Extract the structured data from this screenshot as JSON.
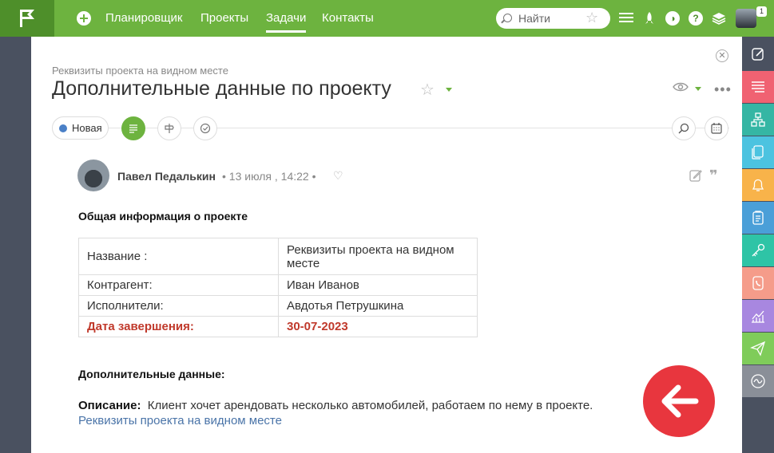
{
  "topbar": {
    "nav": [
      "Планировщик",
      "Проекты",
      "Задачи",
      "Контакты"
    ],
    "active_nav": "Задачи",
    "search_placeholder": "Найти",
    "user_badge": "1",
    "icons": [
      "plus-icon",
      "search-icon",
      "star-icon",
      "hamburger-icon",
      "rocket-icon",
      "contrast-icon",
      "help-icon",
      "layers-icon"
    ]
  },
  "page": {
    "breadcrumb": "Реквизиты проекта на видном месте",
    "title": "Дополнительные данные по проекту",
    "status": "Новая",
    "status_color": "#4a80c7",
    "accent": "#6db33f"
  },
  "post": {
    "author": "Павел Педалькин",
    "meta": "• 13 июля , 14:22 •",
    "general_heading": "Общая информация о проекте",
    "table": [
      {
        "label": "Название :",
        "value": "Реквизиты проекта на видном месте"
      },
      {
        "label": "Контрагент:",
        "value": "Иван Иванов"
      },
      {
        "label": "Исполнители:",
        "value": "Авдотья Петрушкина"
      },
      {
        "label": "Дата завершения:",
        "value": "30-07-2023"
      }
    ],
    "extra_heading": "Дополнительные данные:",
    "description_label": "Описание:",
    "description_text": "Клиент хочет арендовать несколько автомобилей, работаем по нему в проекте.",
    "link": "Реквизиты проекта на видном месте"
  },
  "sidebar": {
    "buttons": [
      {
        "icon": "edit-icon",
        "color": "#4a5160"
      },
      {
        "icon": "list-icon",
        "color": "#f06272"
      },
      {
        "icon": "hierarchy-icon",
        "color": "#35b6a4"
      },
      {
        "icon": "documents-icon",
        "color": "#4cc3e0"
      },
      {
        "icon": "bell-icon",
        "color": "#f8b34a"
      },
      {
        "icon": "clipboard-icon",
        "color": "#4a9fd8"
      },
      {
        "icon": "key-icon",
        "color": "#2ec4a6"
      },
      {
        "icon": "phone-book-icon",
        "color": "#f59c8a"
      },
      {
        "icon": "chart-icon",
        "color": "#a887e0"
      },
      {
        "icon": "send-icon",
        "color": "#7fcc5a"
      },
      {
        "icon": "wave-icon",
        "color": "#8a8f98"
      }
    ]
  }
}
